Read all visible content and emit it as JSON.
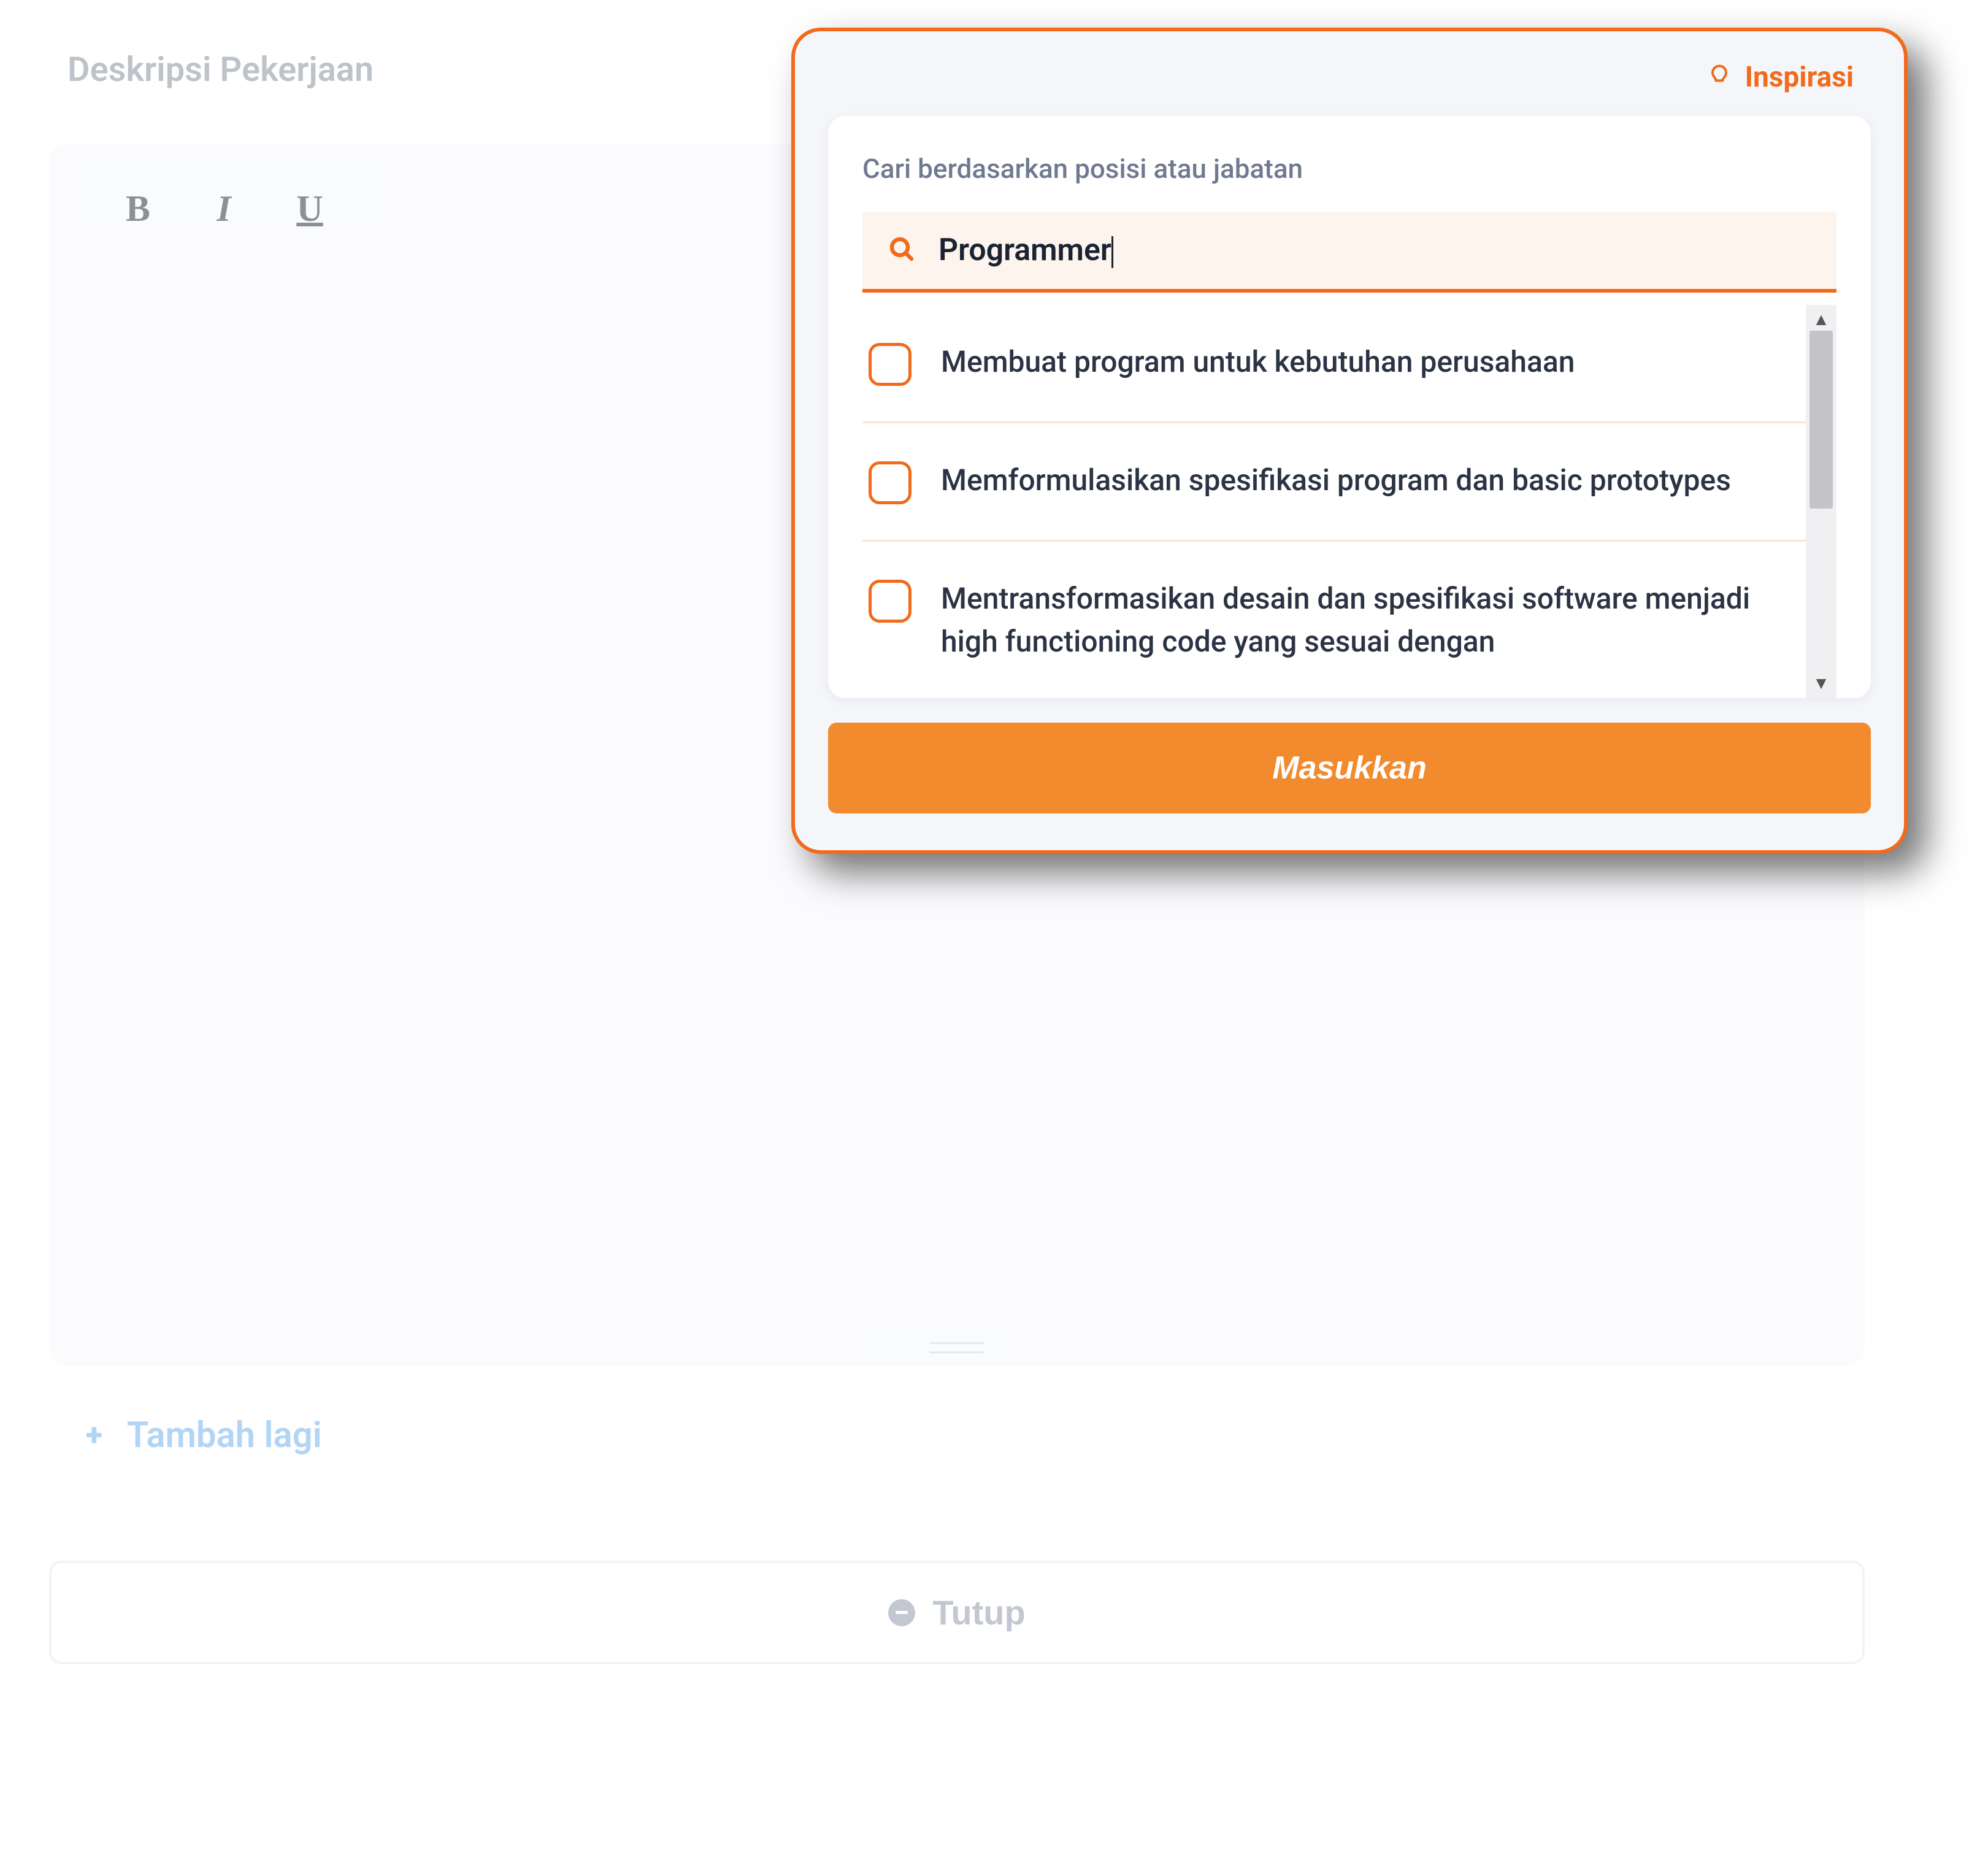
{
  "page": {
    "title": "Deskripsi Pekerjaan"
  },
  "toolbar": {
    "bold": "B",
    "italic": "I",
    "underline": "U"
  },
  "actions": {
    "add_more": "Tambah lagi",
    "close": "Tutup"
  },
  "popover": {
    "title": "Inspirasi",
    "search_label": "Cari berdasarkan posisi atau jabatan",
    "search_value": "Programmer",
    "submit": "Masukkan",
    "results": [
      {
        "text": "Membuat program untuk kebutuhan perusahaan"
      },
      {
        "text": "Memformulasikan spesifikasi program dan basic prototypes"
      },
      {
        "text": "Mentransformasikan desain dan spesifikasi software menjadi high functioning code yang sesuai dengan"
      }
    ]
  },
  "colors": {
    "accent": "#f26a1b",
    "accent_light": "#f28a2e",
    "muted_blue": "#7fb8f0"
  }
}
